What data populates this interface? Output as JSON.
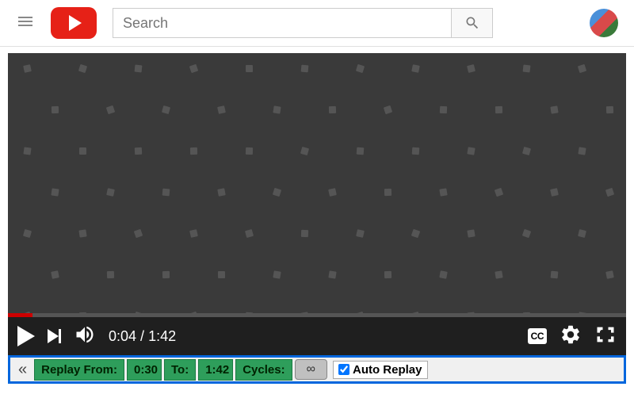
{
  "header": {
    "search_placeholder": "Search"
  },
  "player": {
    "current_time": "0:04",
    "duration": "1:42",
    "time_separator": " / ",
    "cc_label": "CC",
    "progress_percent": 4
  },
  "replay": {
    "collapse_glyph": "«",
    "from_label": "Replay From:",
    "from_value": "0:30",
    "to_label": "To:",
    "to_value": "1:42",
    "cycles_label": "Cycles:",
    "cycles_value": "∞",
    "auto_label": "Auto Replay",
    "auto_checked": true
  },
  "colors": {
    "brand_red": "#e62117",
    "replay_green": "#2e9e5b",
    "frame_blue": "#0066dd"
  }
}
